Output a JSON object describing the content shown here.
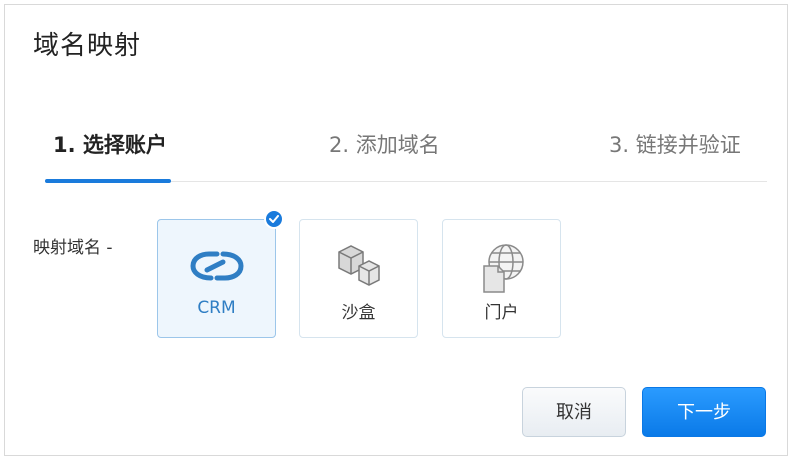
{
  "dialog": {
    "title": "域名映射"
  },
  "steps": [
    {
      "label": "1. 选择账户",
      "active": true
    },
    {
      "label": "2. 添加域名",
      "active": false
    },
    {
      "label": "3. 链接并验证",
      "active": false
    }
  ],
  "mapping": {
    "label": "映射域名 -",
    "options": [
      {
        "label": "CRM",
        "icon": "crm-link-icon",
        "selected": true
      },
      {
        "label": "沙盒",
        "icon": "sandbox-cubes-icon",
        "selected": false
      },
      {
        "label": "门户",
        "icon": "portal-globe-icon",
        "selected": false
      }
    ]
  },
  "buttons": {
    "cancel": "取消",
    "next": "下一步"
  },
  "colors": {
    "accent": "#1a7bdc",
    "selected_bg": "#eef6fd",
    "text": "#333333"
  }
}
